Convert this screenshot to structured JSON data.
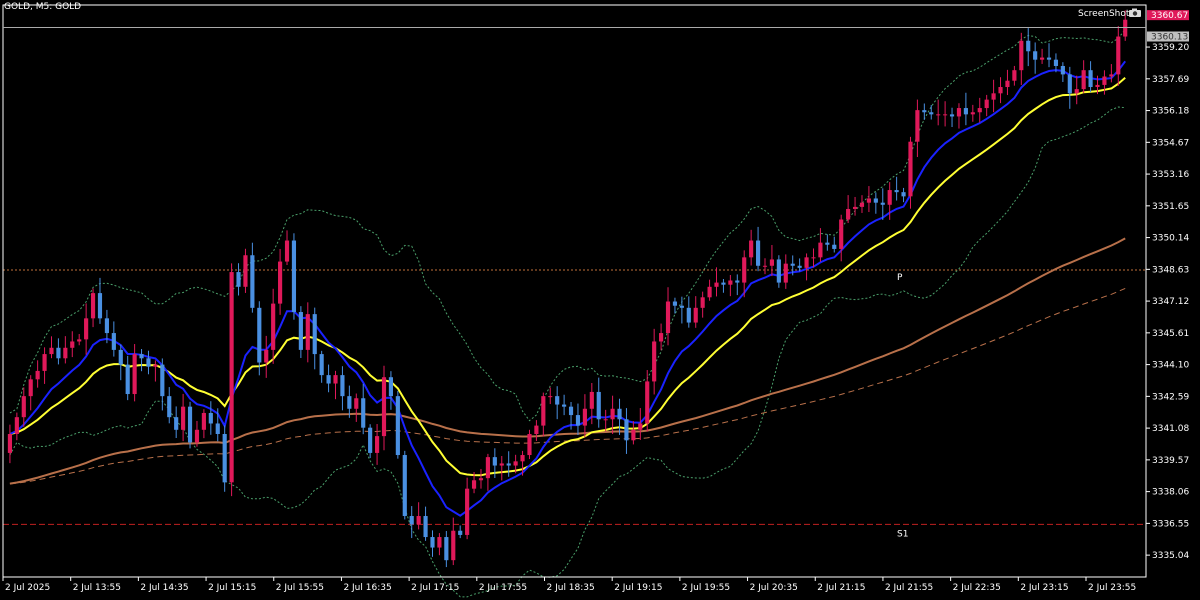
{
  "header": {
    "title": "GOLD, M5:  GOLD",
    "screenshot_label": "ScreenShot"
  },
  "colors": {
    "background": "#000000",
    "bull": "#e0195a",
    "bear": "#4a90e2",
    "ma_fast": "#1a22ff",
    "ma_mid": "#ffff33",
    "ma_slow": "#b8704a",
    "bollinger": "#4a9f6a",
    "pivot": "#c0703a",
    "s1": "#c02020",
    "ask_tag": "#e0195a",
    "bid_tag": "#c0c0c0",
    "axis_text": "#ffffff"
  },
  "icons": {
    "screenshot": "camera-icon"
  },
  "chart_data": {
    "type": "candlestick",
    "symbol": "GOLD",
    "timeframe": "M5",
    "ylim": [
      3334.0,
      3361.2
    ],
    "y_ticks": [
      "3359.20",
      "3357.69",
      "3356.18",
      "3354.67",
      "3353.16",
      "3351.65",
      "3350.14",
      "3348.63",
      "3347.12",
      "3345.61",
      "3344.10",
      "3342.59",
      "3341.08",
      "3339.57",
      "3338.06",
      "3336.55",
      "3335.04"
    ],
    "x_ticks": [
      "2 Jul 2025",
      "2 Jul 13:55",
      "2 Jul 14:35",
      "2 Jul 15:15",
      "2 Jul 15:55",
      "2 Jul 16:35",
      "2 Jul 17:15",
      "2 Jul 17:55",
      "2 Jul 18:35",
      "2 Jul 19:15",
      "2 Jul 19:55",
      "2 Jul 20:35",
      "2 Jul 21:15",
      "2 Jul 21:55",
      "2 Jul 22:35",
      "2 Jul 23:15",
      "2 Jul 23:55"
    ],
    "ask_price": "3360.67",
    "bid_price": "3360.13",
    "pivot_level": 3348.6,
    "pivot_label": "P",
    "s1_level": 3336.5,
    "s1_label": "S1",
    "closes": [
      3340.8,
      3341.6,
      3342.6,
      3343.4,
      3343.8,
      3344.6,
      3344.9,
      3344.4,
      3344.9,
      3345.2,
      3345.3,
      3346.3,
      3347.5,
      3346.3,
      3345.6,
      3344.8,
      3344.1,
      3342.7,
      3344.6,
      3344.4,
      3344.0,
      3344.1,
      3342.6,
      3341.6,
      3341.0,
      3342.1,
      3340.4,
      3341.0,
      3341.8,
      3341.3,
      3340.8,
      3338.5,
      3348.5,
      3347.8,
      3349.3,
      3346.8,
      3344.2,
      3344.8,
      3347.0,
      3349.0,
      3350.0,
      3346.6,
      3344.8,
      3346.5,
      3344.6,
      3343.6,
      3343.2,
      3343.6,
      3342.6,
      3342.0,
      3342.5,
      3341.1,
      3339.9,
      3340.7,
      3343.5,
      3342.6,
      3339.8,
      3336.9,
      3336.5,
      3336.9,
      3335.9,
      3335.4,
      3335.9,
      3334.8,
      3336.2,
      3336.0,
      3338.2,
      3338.6,
      3338.7,
      3339.7,
      3339.3,
      3339.4,
      3339.3,
      3339.5,
      3339.8,
      3340.8,
      3341.2,
      3342.6,
      3342.6,
      3342.2,
      3342.1,
      3341.7,
      3341.2,
      3342.0,
      3342.8,
      3341.5,
      3341.5,
      3342.0,
      3341.5,
      3340.5,
      3341.0,
      3341.3,
      3343.3,
      3345.2,
      3345.6,
      3347.1,
      3346.9,
      3346.8,
      3346.1,
      3346.8,
      3347.3,
      3347.8,
      3348.0,
      3347.9,
      3348.1,
      3348.0,
      3349.2,
      3350.0,
      3348.8,
      3348.8,
      3349.1,
      3348.0,
      3348.9,
      3348.8,
      3348.7,
      3349.2,
      3349.2,
      3349.9,
      3349.8,
      3349.6,
      3351.0,
      3351.5,
      3351.6,
      3351.8,
      3352.0,
      3351.8,
      3351.7,
      3352.4,
      3352.3,
      3352.1,
      3354.7,
      3356.2,
      3356.1,
      3356.0,
      3356.0,
      3356.0,
      3355.9,
      3356.3,
      3356.0,
      3356.1,
      3356.3,
      3356.7,
      3357.0,
      3357.3,
      3357.6,
      3358.1,
      3359.5,
      3359.0,
      3358.6,
      3358.7,
      3358.6,
      3358.3,
      3357.9,
      3357.0,
      3357.2,
      3358.1,
      3357.3,
      3357.4,
      3357.8,
      3357.9,
      3359.7,
      3360.5
    ]
  }
}
